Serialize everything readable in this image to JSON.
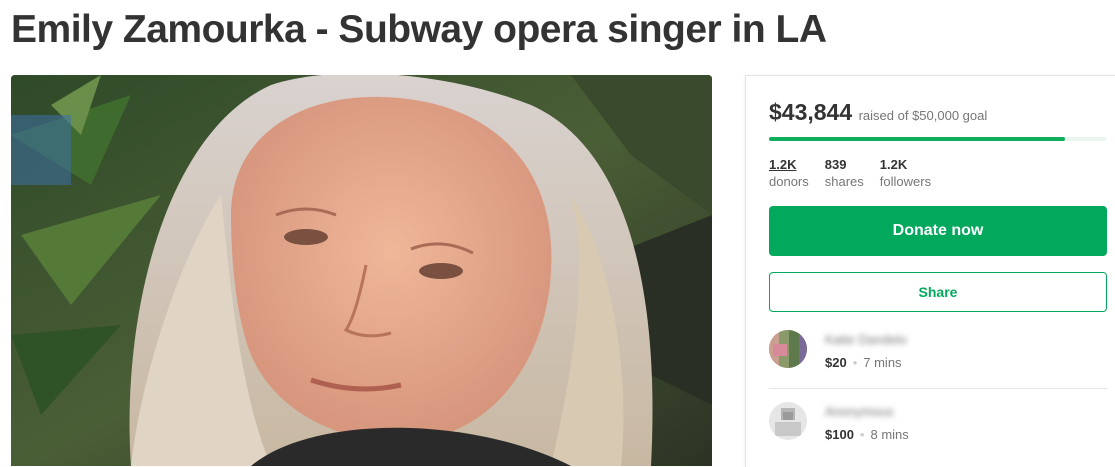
{
  "page": {
    "title": "Emily Zamourka - Subway opera singer in LA"
  },
  "campaign": {
    "amount_raised": "$43,844",
    "goal_text": "raised of $50,000 goal",
    "progress_fraction": 0.877,
    "accent_color": "#02a95c",
    "stats": [
      {
        "value": "1.2K",
        "label": "donors"
      },
      {
        "value": "839",
        "label": "shares"
      },
      {
        "value": "1.2K",
        "label": "followers"
      }
    ],
    "donate_label": "Donate now",
    "share_label": "Share"
  },
  "donations": [
    {
      "name": "Katie Dandelo",
      "amount": "$20",
      "time": "7 mins"
    },
    {
      "name": "Anonymous",
      "amount": "$100",
      "time": "8 mins"
    }
  ]
}
